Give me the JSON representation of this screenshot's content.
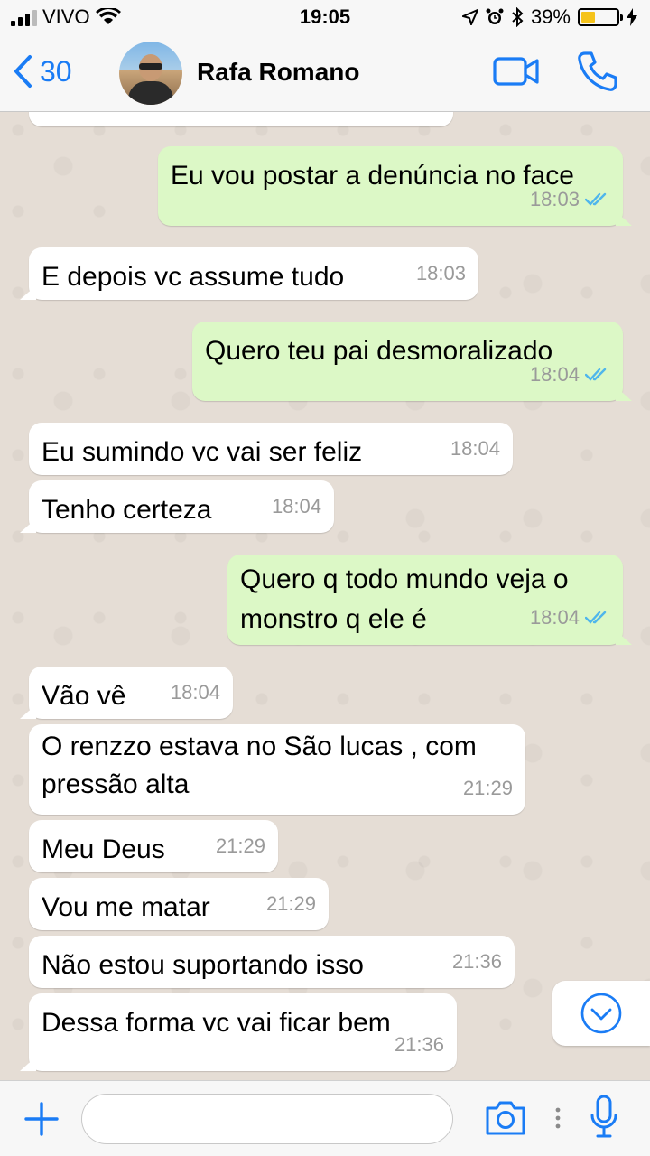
{
  "status_bar": {
    "carrier": "VIVO",
    "time": "19:05",
    "battery_percent": "39%",
    "battery_level": 0.39
  },
  "header": {
    "back_count": "30",
    "contact_name": "Rafa Romano"
  },
  "colors": {
    "accent": "#1a7cf5",
    "outgoing_bubble": "#dcf8c6",
    "incoming_bubble": "#ffffff",
    "chat_background": "#e5ddd5",
    "read_ticks": "#4fb6ec"
  },
  "messages": [
    {
      "direction": "out",
      "text": "Eu vou postar a denúncia no face",
      "time": "18:03",
      "status": "read"
    },
    {
      "direction": "in",
      "text": "E depois vc assume tudo",
      "time": "18:03"
    },
    {
      "direction": "out",
      "text": "Quero teu pai desmoralizado",
      "time": "18:04",
      "status": "read"
    },
    {
      "direction": "in",
      "text": "Eu sumindo vc vai ser feliz",
      "time": "18:04"
    },
    {
      "direction": "in",
      "text": "Tenho certeza",
      "time": "18:04"
    },
    {
      "direction": "out",
      "text": "Quero q todo mundo veja o monstro q ele é",
      "time": "18:04",
      "status": "read"
    },
    {
      "direction": "in",
      "text": "Vão vê",
      "time": "18:04"
    },
    {
      "direction": "in",
      "text": "O renzzo estava no São lucas , com pressão alta",
      "time": "21:29"
    },
    {
      "direction": "in",
      "text": "Meu Deus",
      "time": "21:29"
    },
    {
      "direction": "in",
      "text": "Vou me matar",
      "time": "21:29"
    },
    {
      "direction": "in",
      "text": "Não estou suportando isso",
      "time": "21:36"
    },
    {
      "direction": "in",
      "text": "Dessa forma vc vai ficar bem",
      "time": "21:36"
    }
  ],
  "input": {
    "value": "",
    "placeholder": ""
  },
  "icons": {
    "back": "chevron-left-icon",
    "video": "video-camera-icon",
    "call": "phone-icon",
    "attach": "plus-icon",
    "camera": "camera-icon",
    "mic": "microphone-icon",
    "scroll": "chevron-down-icon"
  }
}
